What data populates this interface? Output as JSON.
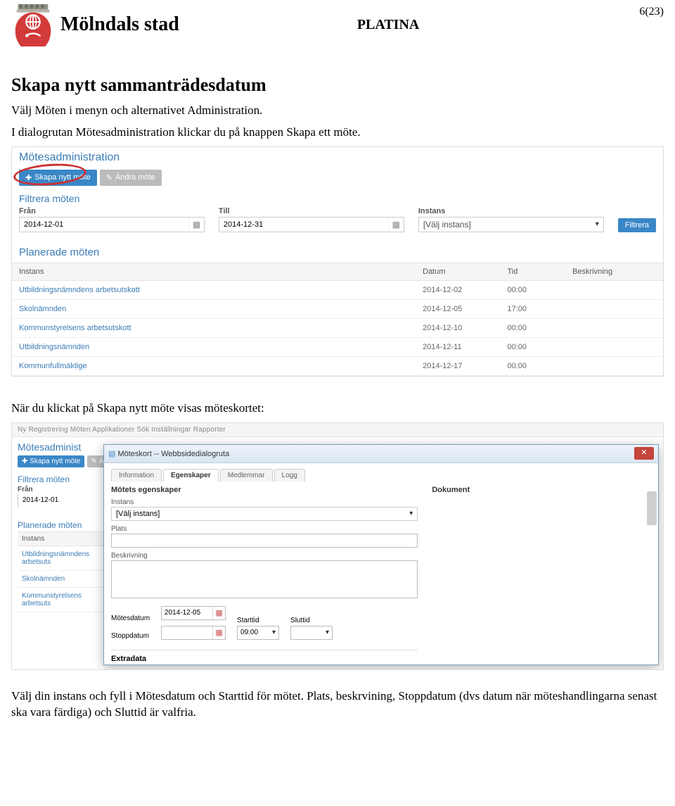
{
  "header": {
    "brand": "Mölndals stad",
    "app_title": "PLATINA",
    "page_indicator": "6(23)"
  },
  "section1": {
    "heading": "Skapa nytt sammanträdesdatum",
    "p1": "Välj Möten i menyn och alternativet Administration.",
    "p2": "I dialogrutan Mötesadministration klickar du på knappen Skapa ett möte."
  },
  "shot1": {
    "title": "Mötesadministration",
    "btn_create": "Skapa nytt möte",
    "btn_edit": "Ändra möte",
    "filter_heading": "Filtrera möten",
    "labels": {
      "from": "Från",
      "to": "Till",
      "instance": "Instans"
    },
    "from_value": "2014-12-01",
    "to_value": "2014-12-31",
    "instance_placeholder": "[Välj instans]",
    "filter_btn": "Filtrera",
    "table_heading": "Planerade möten",
    "columns": {
      "instance": "Instans",
      "date": "Datum",
      "time": "Tid",
      "desc": "Beskrivning"
    },
    "rows": [
      {
        "instance": "Utbildningsnämndens arbetsutskott",
        "date": "2014-12-02",
        "time": "00:00",
        "desc": ""
      },
      {
        "instance": "Skolnämnden",
        "date": "2014-12-05",
        "time": "17:00",
        "desc": ""
      },
      {
        "instance": "Kommunstyrelsens arbetsutskott",
        "date": "2014-12-10",
        "time": "00:00",
        "desc": ""
      },
      {
        "instance": "Utbildningsnämnden",
        "date": "2014-12-11",
        "time": "00:00",
        "desc": ""
      },
      {
        "instance": "Kommunfullmäktige",
        "date": "2014-12-17",
        "time": "00:00",
        "desc": ""
      }
    ]
  },
  "mid_text": "När du klickat på Skapa nytt möte visas möteskortet:",
  "shot2": {
    "topmenu": "Ny    Registrering    Möten    Applikationer    Sök    Inställningar    Rapporter",
    "bg": {
      "title": "Mötesadminist",
      "btn_create": "Skapa nytt möte",
      "btn_edit_short": "Är",
      "filter_heading": "Filtrera möten",
      "from_label": "Från",
      "from_value": "2014-12-01",
      "table_heading": "Planerade möten",
      "col_instance": "Instans",
      "rows": [
        "Utbildningsnämndens arbetsuts",
        "Skolnämnden",
        "Kommunstyrelsens arbetsuts"
      ]
    },
    "dialog": {
      "title": "Möteskort -- Webbsidedialogruta",
      "tabs": [
        "Information",
        "Egenskaper",
        "Medlemmar",
        "Logg"
      ],
      "active_tab": 1,
      "panel_heading_left": "Mötets egenskaper",
      "panel_heading_right": "Dokument",
      "lbl_instance": "Instans",
      "instance_value": "[Välj instans]",
      "lbl_place": "Plats",
      "lbl_desc": "Beskrivning",
      "lbl_meetdate": "Mötesdatum",
      "meetdate_value": "2014-12-05",
      "lbl_start": "Starttid",
      "start_value": "09:00",
      "lbl_end": "Sluttid",
      "end_value": "",
      "lbl_stopdate": "Stoppdatum",
      "extradata": "Extradata"
    }
  },
  "tail": {
    "p1": "Välj din instans och fyll i Mötesdatum och Starttid för mötet.",
    "p2": "Plats, beskrvining, Stoppdatum (dvs datum när möteshandlingarna senast ska vara färdiga) och Sluttid är valfria."
  }
}
